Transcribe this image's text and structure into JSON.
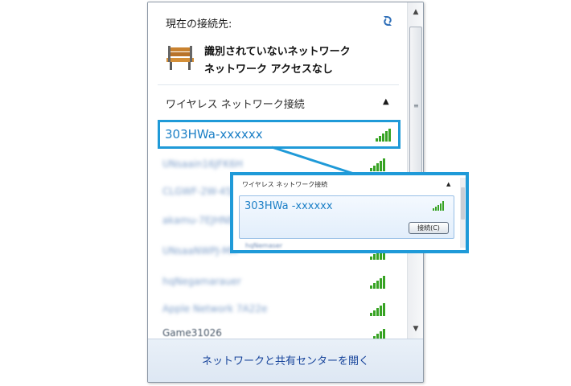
{
  "popup": {
    "current_connection_title": "現在の接続先:",
    "current_network": {
      "name": "識別されていないネットワーク",
      "status": "ネットワーク アクセスなし",
      "icon": "bench-icon"
    },
    "wireless_section_label": "ワイヤレス ネットワーク接続",
    "selected_network": {
      "ssid": "303HWa-xxxxxx",
      "signal_bars": 5
    },
    "networks": [
      {
        "ssid": "UNsaain16JFK6H",
        "signal_bars": 5
      },
      {
        "ssid": "CLGWF-2W-45JH-3",
        "signal_bars": 5
      },
      {
        "ssid": "akamu-7EJHNB",
        "signal_bars": 5
      },
      {
        "ssid": "UNsaaNWPJ-MR",
        "signal_bars": 5
      },
      {
        "ssid": "hqNegamarauer",
        "signal_bars": 5
      },
      {
        "ssid": "Apple Network 7A22e",
        "signal_bars": 5
      },
      {
        "ssid": "Game31026",
        "signal_bars": 5
      }
    ],
    "footer_link": "ネットワークと共有センターを開く",
    "colors": {
      "highlight_border": "#1f9ad8",
      "ssid_text": "#1b7fc6",
      "signal": "#37a323",
      "footer_link": "#17449b"
    }
  },
  "zoom_callout": {
    "section_label": "ワイヤレス ネットワーク接続",
    "ssid": "303HWa -xxxxxx",
    "connect_button_label": "接続(C)",
    "next_network": "hqNemaser",
    "signal_bars": 5
  }
}
